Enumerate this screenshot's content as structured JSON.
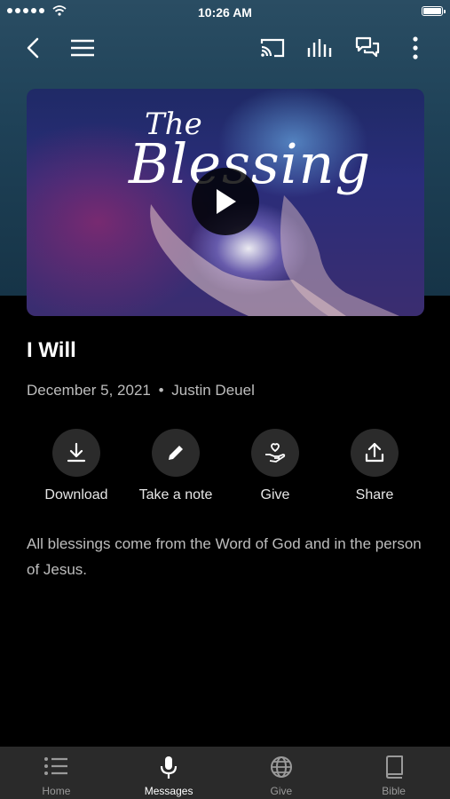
{
  "status_bar": {
    "time": "10:26 AM"
  },
  "toolbar": {
    "back": "back-icon",
    "menu": "menu-icon",
    "cast": "cast-icon",
    "audio": "audio-icon",
    "chat": "chat-icon",
    "more": "more-icon"
  },
  "hero": {
    "title_line1": "The",
    "title_line2": "Blessing"
  },
  "message": {
    "title": "I Will",
    "date": "December 5, 2021",
    "separator": "•",
    "speaker": "Justin Deuel",
    "description": "All blessings come from the Word of God and in the person of Jesus."
  },
  "actions": [
    {
      "label": "Download",
      "icon": "download-icon"
    },
    {
      "label": "Take a note",
      "icon": "pencil-icon"
    },
    {
      "label": "Give",
      "icon": "give-hand-heart-icon"
    },
    {
      "label": "Share",
      "icon": "share-icon"
    }
  ],
  "tabs": [
    {
      "label": "Home",
      "icon": "list-icon",
      "active": false
    },
    {
      "label": "Messages",
      "icon": "microphone-icon",
      "active": true
    },
    {
      "label": "Give",
      "icon": "globe-icon",
      "active": false
    },
    {
      "label": "Bible",
      "icon": "book-icon",
      "active": false
    }
  ],
  "colors": {
    "header_bg": "#1f4258",
    "tabbar_bg": "#2a2a2a",
    "action_circle": "#2b2b2b"
  }
}
